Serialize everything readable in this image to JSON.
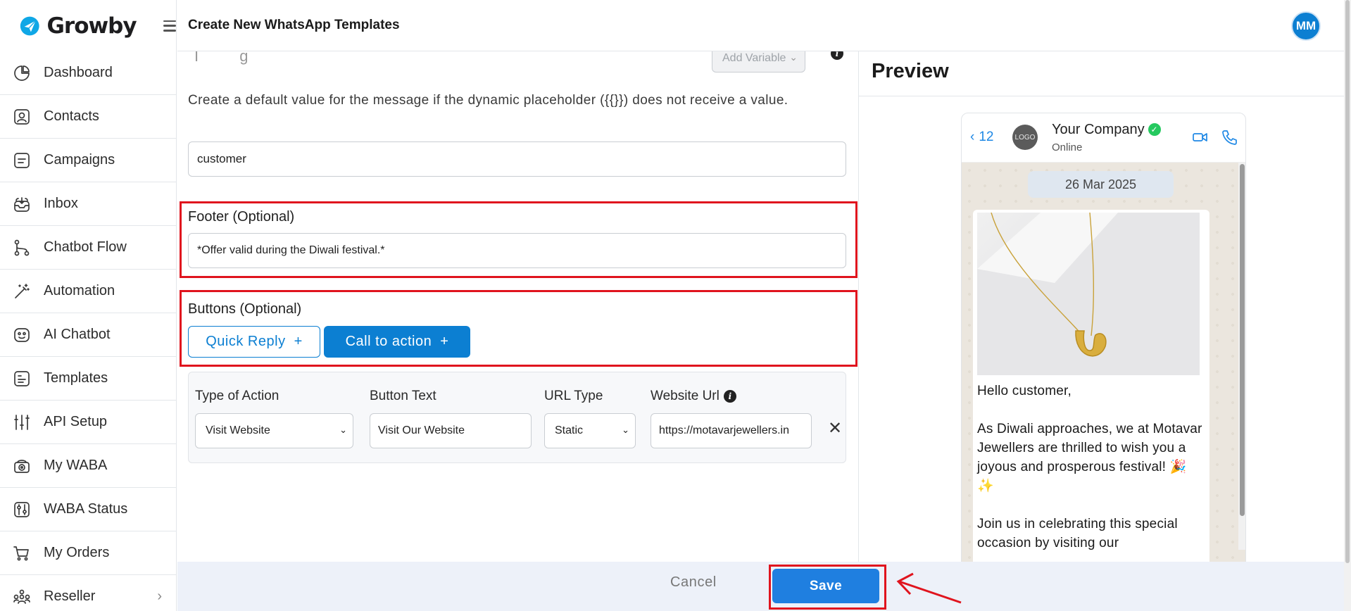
{
  "brand": {
    "name": "Growby"
  },
  "sidebar": {
    "items": [
      {
        "label": "Dashboard",
        "icon": "dashboard-icon"
      },
      {
        "label": "Contacts",
        "icon": "contacts-icon"
      },
      {
        "label": "Campaigns",
        "icon": "campaigns-icon"
      },
      {
        "label": "Inbox",
        "icon": "inbox-icon"
      },
      {
        "label": "Chatbot Flow",
        "icon": "chatbot-flow-icon"
      },
      {
        "label": "Automation",
        "icon": "automation-icon"
      },
      {
        "label": "AI Chatbot",
        "icon": "ai-chatbot-icon"
      },
      {
        "label": "Templates",
        "icon": "templates-icon"
      },
      {
        "label": "API Setup",
        "icon": "api-setup-icon"
      },
      {
        "label": "My WABA",
        "icon": "waba-icon"
      },
      {
        "label": "WABA Status",
        "icon": "waba-status-icon"
      },
      {
        "label": "My Orders",
        "icon": "orders-icon"
      },
      {
        "label": "Reseller",
        "icon": "reseller-icon"
      }
    ]
  },
  "header": {
    "title": "Create New WhatsApp Templates",
    "avatar_initials": "MM"
  },
  "form": {
    "add_variable_placeholder": "Add Variable",
    "default_value_help": "Create a default value for the message if the dynamic placeholder ({{}}) does not receive a value.",
    "default_value": "customer",
    "footer_label": "Footer (Optional)",
    "footer_value": "*Offer valid during the Diwali festival.*",
    "buttons_label": "Buttons (Optional)",
    "quick_reply_label": "Quick Reply",
    "call_to_action_label": "Call to action",
    "plus": "+",
    "action": {
      "type_label": "Type of Action",
      "type_value": "Visit Website",
      "button_text_label": "Button Text",
      "button_text_value": "Visit Our Website",
      "url_type_label": "URL Type",
      "url_type_value": "Static",
      "website_url_label": "Website Url",
      "website_url_value": "https://motavarjewellers.in"
    }
  },
  "preview": {
    "title": "Preview",
    "back_count": "12",
    "logo_text": "LOGO",
    "company": "Your Company",
    "status": "Online",
    "date": "26 Mar 2025",
    "message": "Hello customer,\n\nAs Diwali approaches, we at Motavar Jewellers are thrilled to wish you a joyous and prosperous festival! 🎉 ✨\n\nJoin us in celebrating this special occasion by visiting our"
  },
  "footer_bar": {
    "cancel_label": "Cancel",
    "save_label": "Save"
  },
  "colors": {
    "primary": "#0c7fd2",
    "save": "#1f7fe0",
    "highlight": "#e0141e",
    "verified": "#25c95f"
  }
}
